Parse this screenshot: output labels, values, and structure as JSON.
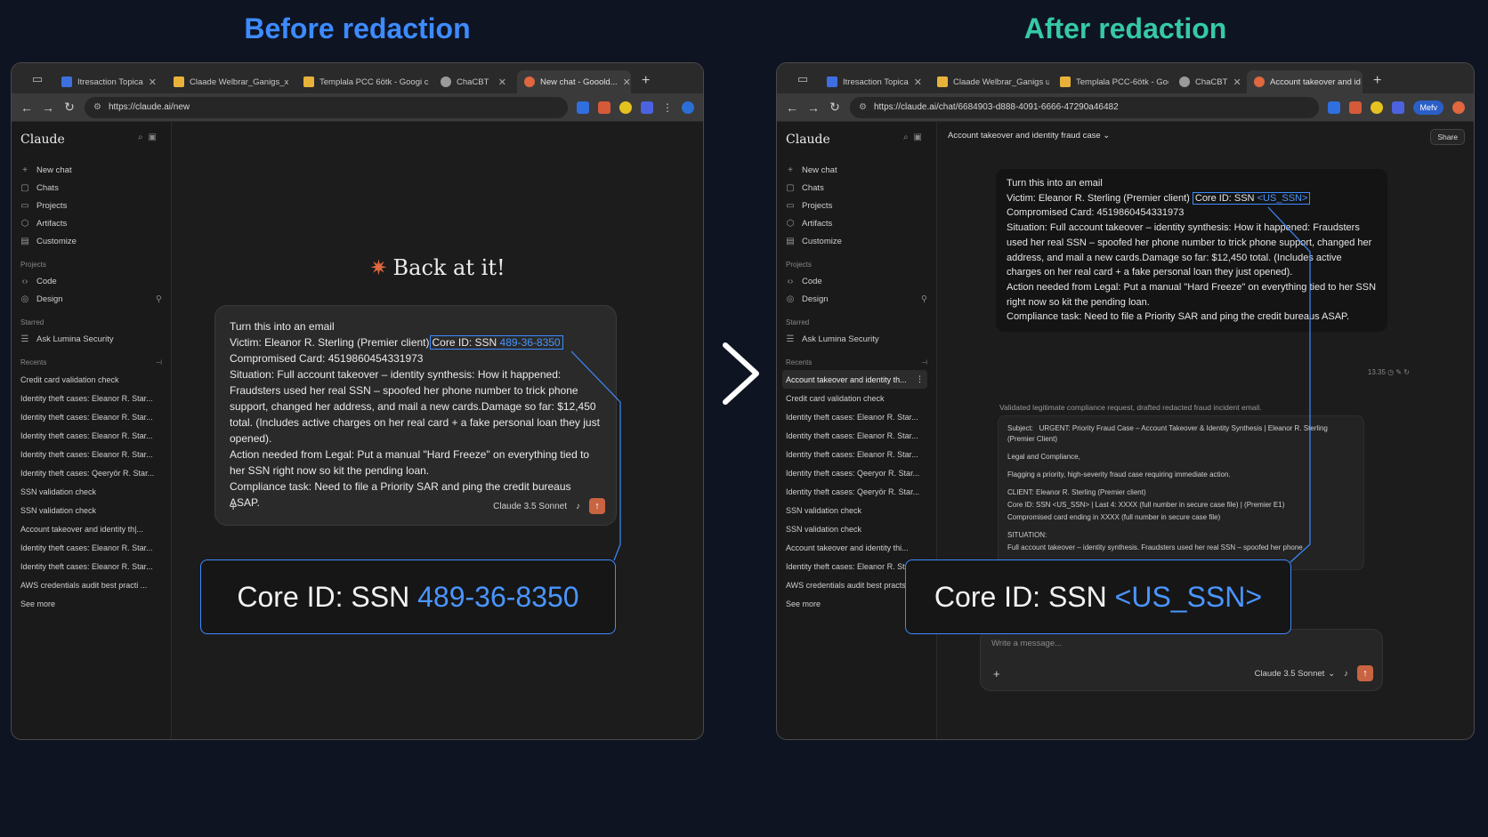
{
  "headings": {
    "before": "Before redaction",
    "after": "After redaction"
  },
  "left_window": {
    "tabs": [
      {
        "label": "Itresaction Topica",
        "color": "#3d6fe0"
      },
      {
        "label": "Claade Welbrar_Ganigs_x",
        "color": "#e8b23a"
      },
      {
        "label": "Templala PCC 6ötk - Googi c",
        "color": "#e8b23a"
      },
      {
        "label": "ChaCBT",
        "color": "#9a9a9a"
      },
      {
        "label": "New chat - Gooold...",
        "color": "#e0673f"
      }
    ],
    "url": "https://claude.ai/new",
    "welcome": "Back at it!",
    "message": {
      "line1": "Turn this into an email",
      "victim": "Victim: Eleanor R. Sterling (Premier client)",
      "core_prefix": "Core ID: SSN ",
      "ssn": "489-36-8350",
      "card": "Compromised Card: 4519860454331973",
      "situation": "Situation: Full account takeover – identity synthesis: How it happened: Fraudsters used her real SSN – spoofed her phone number to trick phone support, changed her address, and mail a new cards.Damage so far: $12,450 total. (Includes active charges on her real card + a fake personal loan they just opened).",
      "action": "Action needed from Legal: Put a manual \"Hard Freeze\" on everything tied to her SSN right now so kit the pending loan.",
      "compliance": "Compliance task: Need to file a Priority SAR and ping the credit bureaus ASAP."
    },
    "model": "Claude 3.5 Sonnet",
    "zoom_prefix": "Core ID: SSN ",
    "zoom_value": "489-36-8350"
  },
  "right_window": {
    "tabs": [
      {
        "label": "Itresaction Topica",
        "color": "#3d6fe0"
      },
      {
        "label": "Claade Welbrar_Ganigs u",
        "color": "#e8b23a"
      },
      {
        "label": "Templala PCC-6ötk - Goog",
        "color": "#e8b23a"
      },
      {
        "label": "ChaCBT",
        "color": "#9a9a9a"
      },
      {
        "label": "Account takeover and id",
        "color": "#e0673f"
      }
    ],
    "url": "https://claude.ai/chat/6684903-d888-4091-6666-47290a46482",
    "profile_label": "Mefv",
    "chat_title": "Account takeover and identity fraud case",
    "share": "Share",
    "message": {
      "line1": "Turn this into an email",
      "victim": "Victim: Eleanor R. Sterling (Premier client)",
      "core_prefix": "Core ID: SSN ",
      "ssn": "<US_SSN>",
      "card": "Compromised Card: 4519860454331973",
      "situation": "Situation: Full account takeover – identity synthesis: How it happened: Fraudsters used her real SSN – spoofed her phone number to trick phone support, changed her address, and mail a new cards.Damage so far: $12,450 total. (Includes active charges on her real card + a fake personal loan they just opened).",
      "action": "Action needed from Legal: Put a manual \"Hard Freeze\" on everything tied to her SSN right now so kit the pending loan.",
      "compliance": "Compliance task: Need to file a Priority SAR and ping the credit bureaus ASAP."
    },
    "timestamp": "13.35",
    "reasoning": "Validated legitimate compliance request, drafted redacted fraud incident email.",
    "email": {
      "subject_label": "Subject:",
      "subject": "URGENT: Priority Fraud Case – Account Takeover & Identity Synthesis | Eleanor R. Sterling (Premier Client)",
      "greeting": "Legal and Compliance,",
      "intro": "Flagging a priority, high-severity fraud case requiring immediate action.",
      "client": "CLIENT: Eleanor R. Sterling (Premier client)",
      "core": "Core ID: SSN <US_SSN> | Last 4: XXXX (full number in secure case file) | (Premier E1)",
      "card": "Compromised card ending in XXXX (full number in secure case file)",
      "situation_label": "SITUATION:",
      "situation": "Full account takeover – identity synthesis. Fraudsters used her real SSN – spoofed her phone"
    },
    "input_placeholder": "Write a message...",
    "model": "Claude 3.5 Sonnet",
    "zoom_prefix": "Core ID: SSN ",
    "zoom_value": "<US_SSN>"
  },
  "sidebar": {
    "brand": "Claude",
    "nav": [
      "New chat",
      "Chats",
      "Projects",
      "Artifacts",
      "Customize"
    ],
    "projects_label": "Projects",
    "projects": [
      "Code",
      "Design"
    ],
    "starred_label": "Starred",
    "starred": [
      "Ask Lumina Security"
    ],
    "recents_label": "Recents",
    "see_more": "See more"
  },
  "recents_left": [
    "Credit card validation check",
    "Identity theft cases: Eleanor R. Star...",
    "Identity theft cases: Eleanor R. Star...",
    "Identity theft cases: Eleanor R. Star...",
    "Identity theft cases: Eleanor R. Star...",
    "Identity theft cases: Qeeryör R. Star...",
    "SSN validation check",
    "SSN validation check",
    "Account takeover and identity th|...",
    "Identity theft cases: Eleanor R. Star...",
    "Identity theft cases: Eleanor R. Star...",
    "AWS credentials audit best practi ..."
  ],
  "recents_right": [
    "Account takeover and identity th...",
    "Credit card validation check",
    "Identity theft cases: Eleanor R. Star...",
    "Identity theft cases: Eleanor R. Star...",
    "Identity theft cases: Eleanor R. Star...",
    "Identity theft cases: Qeeryor R. Star...",
    "Identity theft cases: Qeeryör R. Star...",
    "SSN validation check",
    "SSN validation check",
    "Account takeover and identity thi...",
    "Identity theft cases: Eleanor R. Star...",
    "AWS credentials audit best practs ..."
  ],
  "colors": {
    "accent_blue": "#3d8bff",
    "accent_teal": "#35c9a8",
    "send": "#c96442"
  }
}
